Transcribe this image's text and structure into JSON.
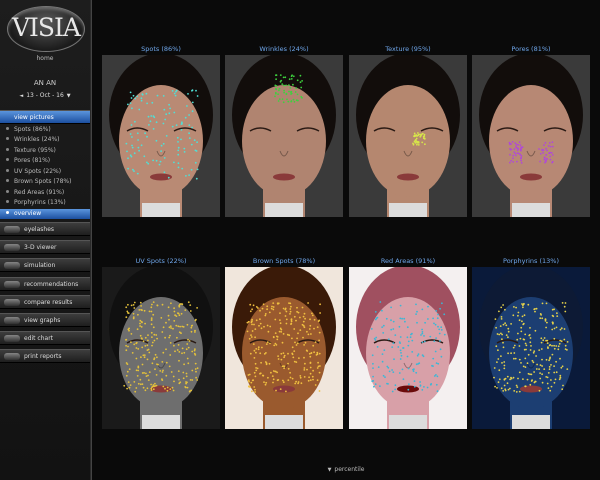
{
  "app": {
    "logo_text": "VISIA",
    "home_label": "home"
  },
  "patient": {
    "name": "AN AN",
    "date": "13 - Oct - 16",
    "prev_arrow": "◄",
    "next_arrow": "▼"
  },
  "sidebar": {
    "view_pictures_label": "view pictures",
    "subitems": [
      {
        "label": "Spots (86%)"
      },
      {
        "label": "Wrinkles (24%)"
      },
      {
        "label": "Texture (95%)"
      },
      {
        "label": "Pores (81%)"
      },
      {
        "label": "UV Spots (22%)"
      },
      {
        "label": "Brown Spots (78%)"
      },
      {
        "label": "Red Areas (91%)"
      },
      {
        "label": "Porphyrins (13%)"
      },
      {
        "label": "overview"
      }
    ],
    "sections": [
      {
        "label": "eyelashes"
      },
      {
        "label": "3-D viewer"
      },
      {
        "label": "simulation"
      },
      {
        "label": "recommendations"
      },
      {
        "label": "compare results"
      },
      {
        "label": "view graphs"
      },
      {
        "label": "edit chart"
      },
      {
        "label": "print reports"
      }
    ]
  },
  "analysis_images": [
    {
      "title": "Spots (86%)",
      "skin": "#b98a74",
      "spot_color": "#4fe0d6"
    },
    {
      "title": "Wrinkles (24%)",
      "skin": "#b08470",
      "spot_color": "#3ed13e"
    },
    {
      "title": "Texture (95%)",
      "skin": "#b5876f",
      "spot_color": "#d7e64a"
    },
    {
      "title": "Pores (81%)",
      "skin": "#b78874",
      "spot_color": "#b04ad6"
    },
    {
      "title": "UV Spots (22%)",
      "skin": "#6e6e6e",
      "spot_color": "#e5c23a"
    },
    {
      "title": "Brown Spots (78%)",
      "skin": "#9a5a2e",
      "spot_color": "#f0c040"
    },
    {
      "title": "Red Areas (91%)",
      "skin": "#d8a0a8",
      "spot_color": "#3ab7d6"
    },
    {
      "title": "Porphyrins (13%)",
      "skin": "#1c3e72",
      "spot_color": "#e6d24a"
    }
  ],
  "footer": {
    "percentile_label": "percentile",
    "arrow": "▼"
  }
}
